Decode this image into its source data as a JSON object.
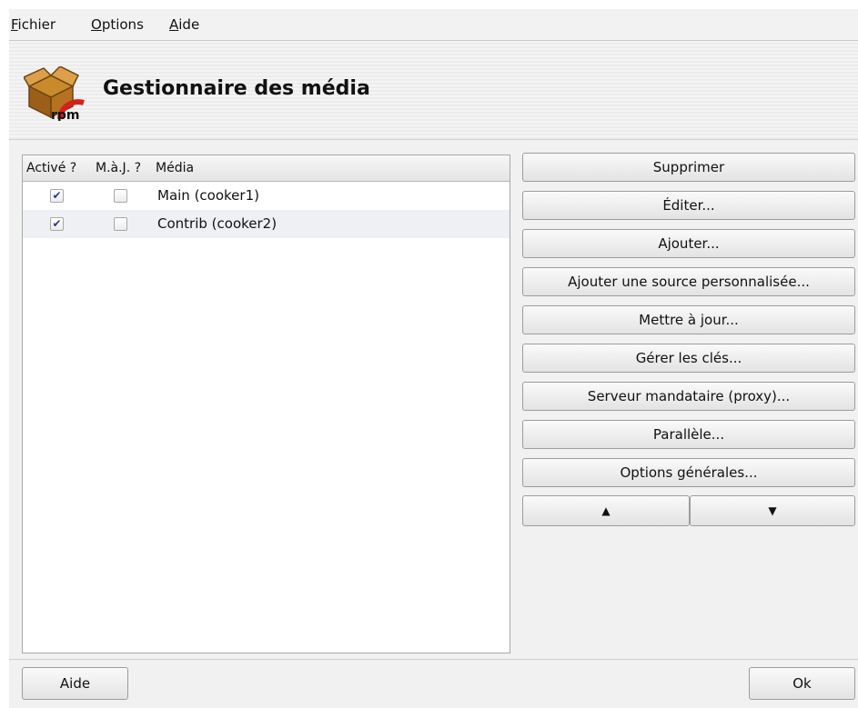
{
  "menubar": {
    "items": [
      {
        "mnemonic": "F",
        "rest": "ichier"
      },
      {
        "mnemonic": "O",
        "rest": "ptions"
      },
      {
        "mnemonic": "A",
        "rest": "ide"
      }
    ]
  },
  "banner": {
    "icon": "rpm-box-icon",
    "icon_text": "rpm",
    "title": "Gestionnaire des média"
  },
  "media_list": {
    "columns": [
      "Activé ?",
      "M.à.J. ?",
      "Média"
    ],
    "rows": [
      {
        "enabled": true,
        "update": false,
        "label": "Main (cooker1)"
      },
      {
        "enabled": true,
        "update": false,
        "label": "Contrib (cooker2)"
      }
    ]
  },
  "actions": {
    "remove": "Supprimer",
    "edit": "Éditer...",
    "add": "Ajouter...",
    "add_custom": "Ajouter une source personnalisée...",
    "update": "Mettre à jour...",
    "manage_keys": "Gérer les clés...",
    "proxy": "Serveur mandataire (proxy)...",
    "parallel": "Parallèle...",
    "global_options": "Options générales...",
    "move_up_icon": "▲",
    "move_down_icon": "▼"
  },
  "footer": {
    "help": "Aide",
    "ok": "Ok"
  }
}
